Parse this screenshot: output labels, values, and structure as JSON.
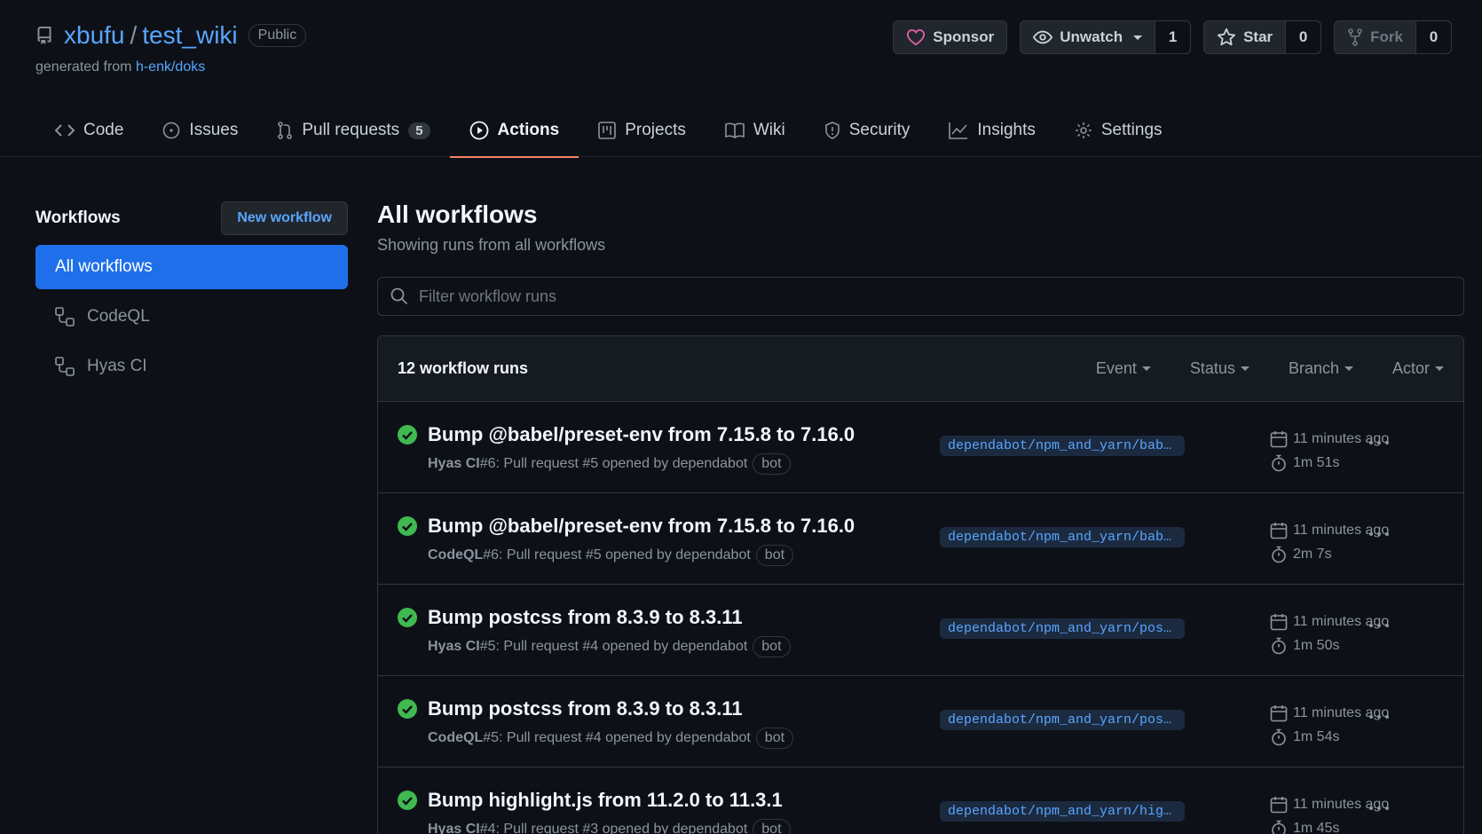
{
  "repo": {
    "owner": "xbufu",
    "separator": "/",
    "name": "test_wiki",
    "visibility": "Public",
    "generated_prefix": "generated from ",
    "generated_link": "h-enk/doks"
  },
  "header_buttons": {
    "sponsor": "Sponsor",
    "unwatch": "Unwatch",
    "unwatch_count": "1",
    "star": "Star",
    "star_count": "0",
    "fork": "Fork",
    "fork_count": "0"
  },
  "tabs": [
    {
      "label": "Code"
    },
    {
      "label": "Issues"
    },
    {
      "label": "Pull requests",
      "count": "5"
    },
    {
      "label": "Actions"
    },
    {
      "label": "Projects"
    },
    {
      "label": "Wiki"
    },
    {
      "label": "Security"
    },
    {
      "label": "Insights"
    },
    {
      "label": "Settings"
    }
  ],
  "sidebar": {
    "title": "Workflows",
    "new_workflow": "New workflow",
    "items": [
      {
        "label": "All workflows"
      },
      {
        "label": "CodeQL"
      },
      {
        "label": "Hyas CI"
      }
    ]
  },
  "main": {
    "title": "All workflows",
    "subtitle": "Showing runs from all workflows",
    "filter_placeholder": "Filter workflow runs",
    "runs_count": "12 workflow runs",
    "filters": [
      "Event",
      "Status",
      "Branch",
      "Actor"
    ]
  },
  "runs": [
    {
      "title": "Bump @babel/preset-env from 7.15.8 to 7.16.0",
      "workflow": "Hyas CI",
      "detail": " #6: Pull request #5 opened by dependabot",
      "badge": "bot",
      "branch": "dependabot/npm_and_yarn/bab…",
      "time": "11 minutes ago",
      "duration": "1m 51s"
    },
    {
      "title": "Bump @babel/preset-env from 7.15.8 to 7.16.0",
      "workflow": "CodeQL",
      "detail": " #6: Pull request #5 opened by dependabot",
      "badge": "bot",
      "branch": "dependabot/npm_and_yarn/bab…",
      "time": "11 minutes ago",
      "duration": "2m 7s"
    },
    {
      "title": "Bump postcss from 8.3.9 to 8.3.11",
      "workflow": "Hyas CI",
      "detail": " #5: Pull request #4 opened by dependabot",
      "badge": "bot",
      "branch": "dependabot/npm_and_yarn/pos…",
      "time": "11 minutes ago",
      "duration": "1m 50s"
    },
    {
      "title": "Bump postcss from 8.3.9 to 8.3.11",
      "workflow": "CodeQL",
      "detail": " #5: Pull request #4 opened by dependabot",
      "badge": "bot",
      "branch": "dependabot/npm_and_yarn/pos…",
      "time": "11 minutes ago",
      "duration": "1m 54s"
    },
    {
      "title": "Bump highlight.js from 11.2.0 to 11.3.1",
      "workflow": "Hyas CI",
      "detail": " #4: Pull request #3 opened by dependabot",
      "badge": "bot",
      "branch": "dependabot/npm_and_yarn/hig…",
      "time": "11 minutes ago",
      "duration": "1m 45s"
    }
  ]
}
